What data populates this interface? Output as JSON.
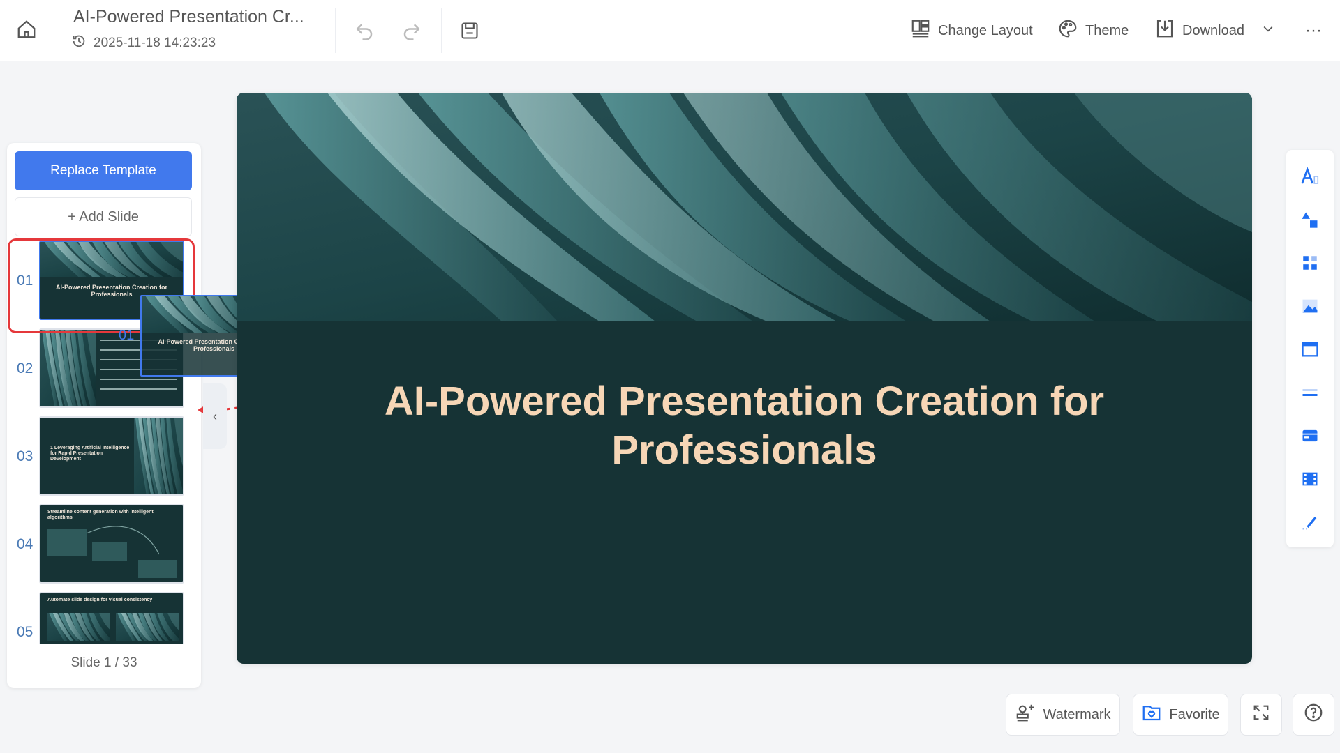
{
  "header": {
    "title": "AI-Powered Presentation Cr...",
    "timestamp": "2025-11-18 14:23:23",
    "actions": {
      "change_layout": "Change Layout",
      "theme": "Theme",
      "download": "Download"
    }
  },
  "sidebar": {
    "replace_template": "Replace Template",
    "add_slide": "+ Add Slide",
    "slides": [
      {
        "number": "01",
        "title": "AI-Powered Presentation Creation for Professionals"
      },
      {
        "number": "02",
        "title": ""
      },
      {
        "number": "03",
        "title": "1 Leveraging Artificial Intelligence for Rapid Presentation Development"
      },
      {
        "number": "04",
        "title": "Streamline content generation with intelligent algorithms"
      },
      {
        "number": "05",
        "title": "Automate slide design for visual consistency"
      }
    ],
    "drag_ghost_number": "01",
    "drag_ghost_title": "AI-Powered Presentation Creation for Professionals",
    "counter": "Slide 1 / 33"
  },
  "slide": {
    "title": "AI-Powered Presentation Creation for Professionals"
  },
  "bottom": {
    "watermark": "Watermark",
    "favorite": "Favorite"
  },
  "colors": {
    "accent": "#4179ed",
    "slide_bg": "#163335",
    "slide_title": "#f6d6b6",
    "highlight": "#e5383b"
  }
}
